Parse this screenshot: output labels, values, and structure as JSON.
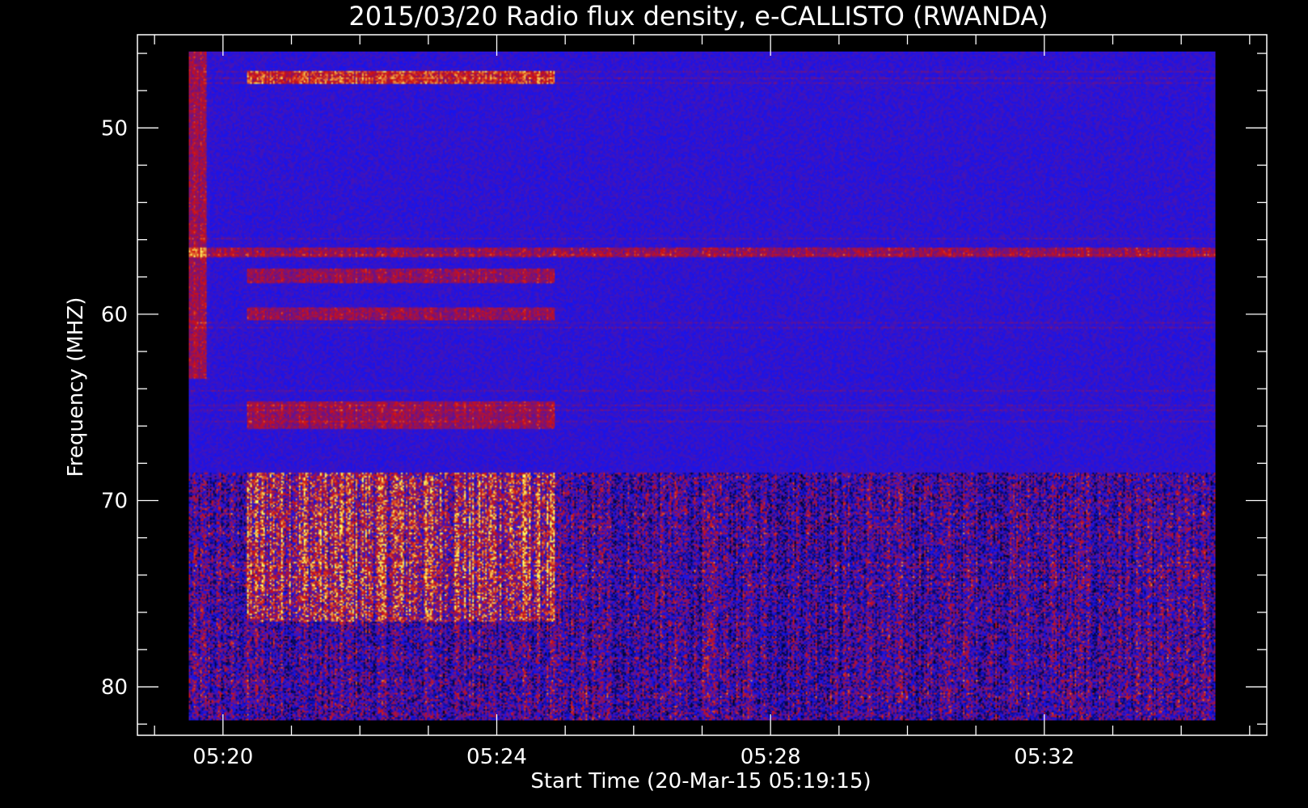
{
  "chart_data": {
    "type": "heatmap",
    "title": "2015/03/20  Radio flux density, e-CALLISTO (RWANDA)",
    "xlabel": "Start Time (20-Mar-15 05:19:15)",
    "ylabel": "Frequency (MHZ)",
    "x_unit": "UT time",
    "xlim": [
      "05:18:45",
      "05:35:15"
    ],
    "data_time_range": [
      "05:19:30",
      "05:34:30"
    ],
    "x_ticks": [
      "05:20",
      "05:24",
      "05:28",
      "05:32"
    ],
    "ylim": [
      45,
      82.6
    ],
    "y_axis_inverted": true,
    "data_freq_range": [
      45.9,
      81.8
    ],
    "y_ticks": [
      50,
      60,
      70,
      80
    ],
    "colormap": {
      "low": "#000000",
      "background": "#1414f0",
      "mid": "#d01010",
      "high": "#ffff60"
    },
    "features": [
      {
        "kind": "strong emission band",
        "time_start": "05:20:20",
        "time_end": "05:24:50",
        "freq_start": 46.9,
        "freq_end": 47.6,
        "intensity": "high"
      },
      {
        "kind": "emission band",
        "time_start": "05:20:20",
        "time_end": "05:24:50",
        "freq_start": 57.5,
        "freq_end": 58.3,
        "intensity": "mid"
      },
      {
        "kind": "emission band",
        "time_start": "05:20:20",
        "time_end": "05:24:50",
        "freq_start": 59.6,
        "freq_end": 60.3,
        "intensity": "mid"
      },
      {
        "kind": "emission band",
        "time_start": "05:20:20",
        "time_end": "05:24:50",
        "freq_start": 64.7,
        "freq_end": 66.2,
        "intensity": "mid"
      },
      {
        "kind": "broadband emission",
        "time_start": "05:20:20",
        "time_end": "05:24:50",
        "freq_start": 68.5,
        "freq_end": 76.5,
        "intensity": "mid-high"
      },
      {
        "kind": "RFI line",
        "time_start": "05:19:30",
        "time_end": "05:34:30",
        "freq_start": 56.4,
        "freq_end": 56.9,
        "intensity": "mid"
      },
      {
        "kind": "noisy band",
        "time_start": "05:19:30",
        "time_end": "05:34:30",
        "freq_start": 68.5,
        "freq_end": 81.8,
        "intensity": "mixed"
      },
      {
        "kind": "calibration edge",
        "time_start": "05:19:30",
        "time_end": "05:19:45",
        "freq_start": 45.9,
        "freq_end": 63.5,
        "intensity": "mid"
      }
    ]
  }
}
